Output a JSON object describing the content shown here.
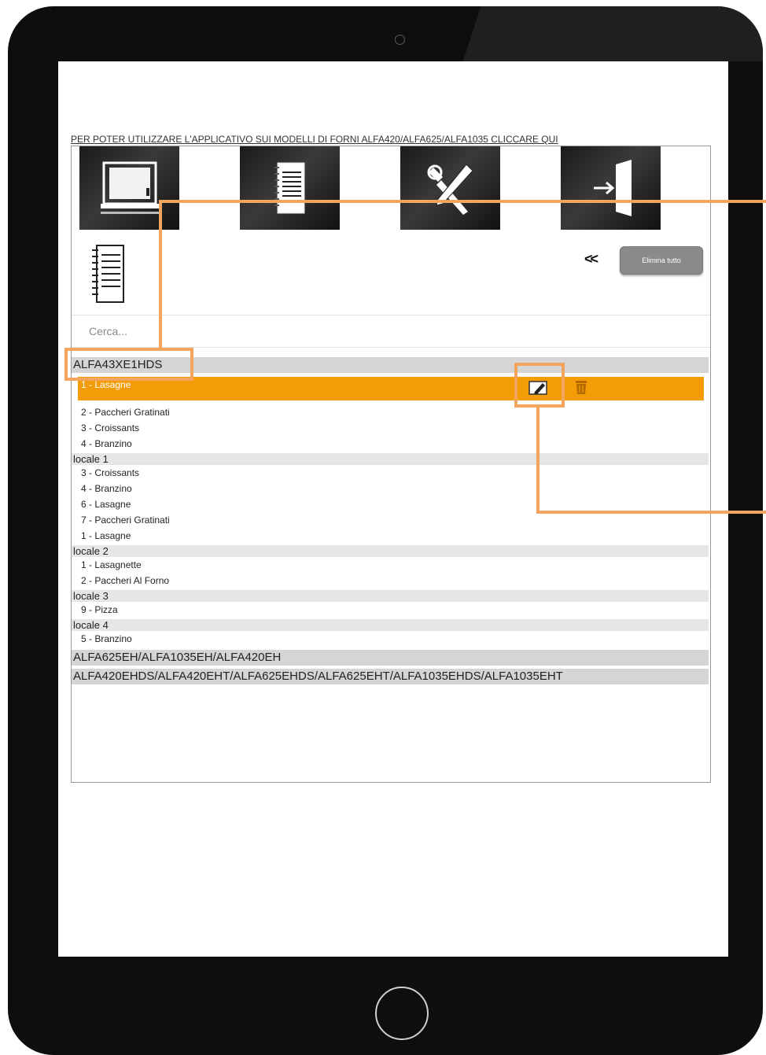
{
  "notice": "PER POTER UTILIZZARE L'APPLICATIVO SUI MODELLI DI FORNI ALFA420/ALFA625/ALFA1035 CLICCARE QUI",
  "toolbar": {
    "tiles": [
      {
        "icon": "oven-icon"
      },
      {
        "icon": "recipe-book-icon"
      },
      {
        "icon": "tools-icon"
      },
      {
        "icon": "exit-door-icon"
      }
    ]
  },
  "header": {
    "icon": "recipe-book-icon",
    "back": "<<",
    "delete_all_label": "Elimina tutto"
  },
  "search": {
    "placeholder": "Cerca..."
  },
  "groups": [
    {
      "title": "ALFA43XE1HDS",
      "recipes": [
        "1 - Lasagne",
        "2 - Paccheri Gratinati",
        "3 - Croissants",
        "4 - Branzino"
      ],
      "selected_index": 0
    },
    {
      "title": "locale 1",
      "recipes": [
        "3 - Croissants",
        "4 - Branzino",
        "6 - Lasagne",
        "7 - Paccheri Gratinati",
        "1 - Lasagne"
      ]
    },
    {
      "title": "locale 2",
      "recipes": [
        "1 - Lasagnette",
        "2 - Paccheri Al Forno"
      ]
    },
    {
      "title": "locale 3",
      "recipes": [
        "9 - Pizza"
      ]
    },
    {
      "title": "locale 4",
      "recipes": [
        "5 - Branzino"
      ]
    },
    {
      "title": "ALFA625EH/ALFA1035EH/ALFA420EH",
      "recipes": []
    },
    {
      "title": "ALFA420EHDS/ALFA420EHT/ALFA625EHDS/ALFA625EHT/ALFA1035EHDS/ALFA1035EHT",
      "recipes": []
    }
  ],
  "colors": {
    "selected_row": "#f49c07",
    "callout": "#f3a45f",
    "group_header": "#d5d5d5",
    "bezel": "#0e0e0e"
  }
}
